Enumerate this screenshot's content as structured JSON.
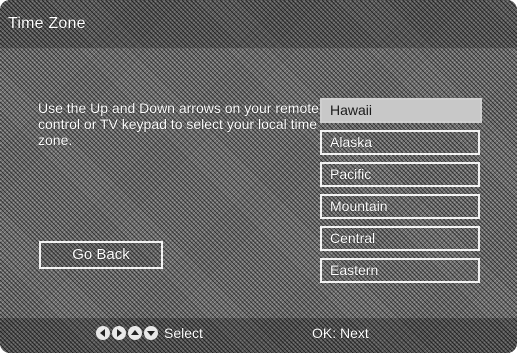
{
  "header": {
    "title": "Time Zone"
  },
  "instructions": {
    "text": "Use the Up and Down arrows on your remote control or TV keypad to select your local time zone."
  },
  "buttons": {
    "go_back_label": "Go Back"
  },
  "time_zones": [
    {
      "label": "Hawaii",
      "selected": true
    },
    {
      "label": "Alaska",
      "selected": false
    },
    {
      "label": "Pacific",
      "selected": false
    },
    {
      "label": "Mountain",
      "selected": false
    },
    {
      "label": "Central",
      "selected": false
    },
    {
      "label": "Eastern",
      "selected": false
    }
  ],
  "footer": {
    "nav_icons": [
      "arrow-left-icon",
      "arrow-right-icon",
      "arrow-up-icon",
      "arrow-down-icon"
    ],
    "select_hint": "Select",
    "ok_hint": "OK: Next"
  },
  "colors": {
    "text": "#ffffff",
    "selected_fill": "#c8c8c8",
    "border": "#f2f2f2"
  }
}
